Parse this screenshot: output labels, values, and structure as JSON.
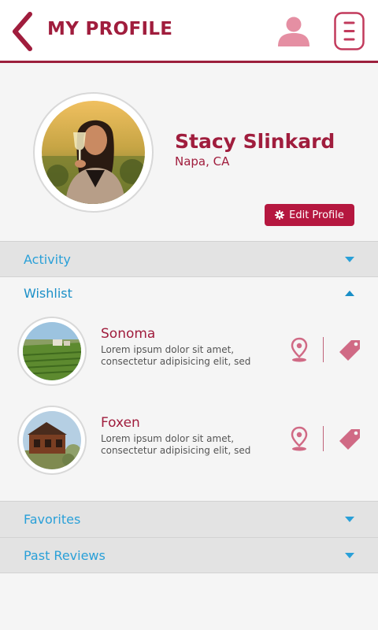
{
  "header": {
    "title": "MY PROFILE",
    "icons": {
      "back": "chevron-left-icon",
      "user": "user-icon",
      "menu": "menu-icon"
    }
  },
  "profile": {
    "name": "Stacy Slinkard",
    "location": "Napa, CA",
    "edit_label": "Edit Profile"
  },
  "sections": {
    "activity": "Activity",
    "wishlist": "Wishlist",
    "favorites": "Favorites",
    "past_reviews": "Past Reviews"
  },
  "wishlist": {
    "items": [
      {
        "title": "Sonoma",
        "description": "Lorem ipsum dolor sit amet, consectetur adipisicing elit, sed"
      },
      {
        "title": "Foxen",
        "description": "Lorem ipsum dolor sit amet, consectetur adipisicing elit, sed"
      }
    ]
  },
  "colors": {
    "brand": "#a01d3d",
    "button": "#b5173f",
    "link": "#2aa0d8",
    "pink_icon": "#d06a85"
  }
}
